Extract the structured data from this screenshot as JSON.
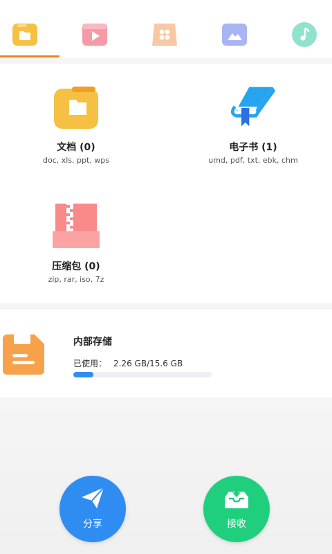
{
  "tabs": [
    {
      "name": "folder-tab-icon",
      "color": "#f6c042",
      "selected": true
    },
    {
      "name": "video-tab-icon",
      "color": "#f79aa8",
      "selected": false
    },
    {
      "name": "apps-tab-icon",
      "color": "#f7c9a3",
      "selected": false
    },
    {
      "name": "image-tab-icon",
      "color": "#a9b4f5",
      "selected": false
    },
    {
      "name": "music-tab-icon",
      "color": "#8fe3cd",
      "selected": false
    }
  ],
  "accent": "#ef7d22",
  "categories": [
    {
      "title": "文档 (0)",
      "sub": "doc, xls, ppt, wps",
      "icon": "folder-icon"
    },
    {
      "title": "电子书 (1)",
      "sub": "umd, pdf, txt, ebk, chm",
      "icon": "ebook-icon"
    },
    {
      "title": "压缩包 (0)",
      "sub": "zip, rar, iso, 7z",
      "icon": "archive-icon"
    }
  ],
  "storage": {
    "title": "内部存储",
    "used_label": "已使用：",
    "used_value": "2.26 GB/15.6 GB",
    "used_fraction": 0.145,
    "icon": "storage-icon"
  },
  "actions": {
    "share_label": "分享",
    "receive_label": "接收"
  }
}
